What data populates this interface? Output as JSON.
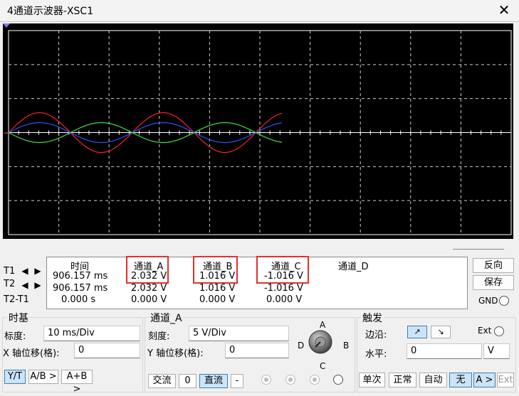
{
  "window": {
    "title": "4通道示波器-XSC1",
    "close_glyph": "✕"
  },
  "scope": {
    "channels": [
      {
        "name": "A",
        "color": "#ff2020",
        "amplitude": 2.032
      },
      {
        "name": "B",
        "color": "#3050ff",
        "amplitude": 1.016
      },
      {
        "name": "C",
        "color": "#40e040",
        "amplitude": -1.016
      }
    ]
  },
  "readout": {
    "headers": {
      "time": "时间",
      "a": "通道_A",
      "b": "通道_B",
      "c": "通道_C",
      "d": "通道_D"
    },
    "rows": [
      {
        "label": "T1",
        "time": "906.157 ms",
        "a": "2.032 V",
        "b": "1.016 V",
        "c": "-1.016 V"
      },
      {
        "label": "T2",
        "time": "906.157 ms",
        "a": "2.032 V",
        "b": "1.016 V",
        "c": "-1.016 V"
      },
      {
        "label": "T2-T1",
        "time": "0.000 s",
        "a": "0.000 V",
        "b": "0.000 V",
        "c": "0.000 V"
      }
    ],
    "reverse_button": "反向",
    "save_button": "保存",
    "gnd_label": "GND"
  },
  "timebase": {
    "title": "时基",
    "scale_label": "标度:",
    "scale_value": "10 ms/Div",
    "x_offset_label": "X 轴位移(格):",
    "x_offset_value": "0",
    "modes": [
      "Y/T",
      "A/B >",
      "A+B >"
    ]
  },
  "channel": {
    "title": "通道_A",
    "scale_label": "刻度:",
    "scale_value": "5  V/Div",
    "y_offset_label": "Y 轴位移(格):",
    "y_offset_value": "0",
    "coupling": [
      "交流",
      "0",
      "直流",
      "-"
    ],
    "knob_labels": {
      "a": "A",
      "b": "B",
      "c": "C",
      "d": "D"
    }
  },
  "trigger": {
    "title": "触发",
    "edge_label": "边沿:",
    "edge_rise": "↗",
    "edge_fall": "↘",
    "ext_label": "Ext",
    "level_label": "水平:",
    "level_value": "0",
    "level_unit": "V",
    "modes": [
      "单次",
      "正常",
      "自动",
      "无",
      "A >",
      "Ext"
    ]
  }
}
